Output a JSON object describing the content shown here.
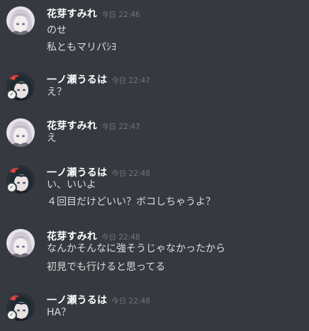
{
  "messages": [
    {
      "author": "花芽すみれ",
      "timestamp": "今日 22:46",
      "avatar": "sumire",
      "lines": [
        "のせ",
        "私ともマリパｼﾖ"
      ]
    },
    {
      "author": "一ノ瀬うるは",
      "timestamp": "今日 22:47",
      "avatar": "uruha",
      "lines": [
        "え？"
      ]
    },
    {
      "author": "花芽すみれ",
      "timestamp": "今日 22:47",
      "avatar": "sumire",
      "lines": [
        "え"
      ]
    },
    {
      "author": "一ノ瀬うるは",
      "timestamp": "今日 22:48",
      "avatar": "uruha",
      "lines": [
        "い、いいよ",
        "４回目だけどいい？ボコしちゃうよ？"
      ]
    },
    {
      "author": "花芽すみれ",
      "timestamp": "今日 22:48",
      "avatar": "sumire",
      "lines": [
        "なんかそんなに強そうじゃなかったから",
        "初見でも行けると思ってる"
      ]
    },
    {
      "author": "一ノ瀬うるは",
      "timestamp": "今日 22:48",
      "avatar": "uruha",
      "lines": [
        "HA？"
      ]
    }
  ],
  "colors": {
    "background": "#36393f",
    "author": "#ffffff",
    "timestamp": "#72767d",
    "text": "#dcddde"
  }
}
